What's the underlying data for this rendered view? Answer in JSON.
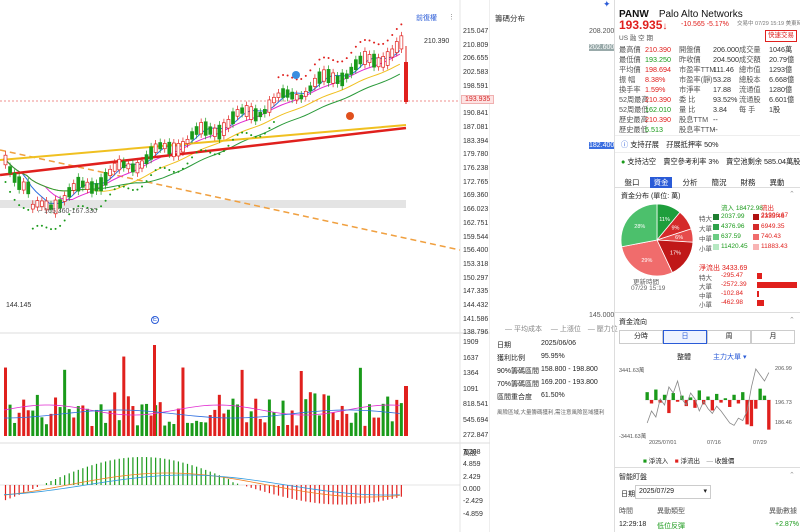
{
  "toolbar": {
    "restore_label": "前復權",
    "dist_label": "籌碼分布"
  },
  "price_axis": [
    "215.047",
    "210.809",
    "206.655",
    "202.583",
    "198.591",
    "194.677",
    "190.841",
    "187.081",
    "183.394",
    "179.780",
    "176.238",
    "172.765",
    "169.360",
    "166.023",
    "162.751",
    "159.544",
    "156.400",
    "153.318",
    "150.297",
    "147.335",
    "144.432",
    "141.586",
    "138.796"
  ],
  "current_price_tag": "193.935",
  "chart_annotations": {
    "high": "210.390",
    "low": "144.145",
    "gap": "165.360-167.330"
  },
  "dist_axis": {
    "top": "208.200",
    "p1": "202.600",
    "p2": "182.400",
    "bottom": "145.000"
  },
  "dist_legend": {
    "avg": "平均成本",
    "up": "上漲位",
    "pressure": "壓力位"
  },
  "dist_info": {
    "date_label": "日期",
    "date": "2025/06/06",
    "profit_label": "獲利比例",
    "profit": "95.95%",
    "r90_label": "90%籌碼區間",
    "r90": "158.800 - 198.800",
    "r70_label": "70%籌碼區間",
    "r70": "169.200 - 193.800",
    "conc_label": "區間重合度",
    "conc": "61.50%",
    "note": "風險區域,大量籌碼獲利,需注意風險區域獲利"
  },
  "volume_axis": [
    "1909",
    "1637",
    "1364",
    "1091",
    "818.541",
    "545.694",
    "272.847",
    "萬股"
  ],
  "macd_axis": [
    "7.288",
    "4.859",
    "2.429",
    "0.000",
    "-2.429",
    "-4.859"
  ],
  "header": {
    "symbol": "PANW",
    "name": "Palo Alto Networks",
    "price": "193.935",
    "arrow": "↓",
    "change": "-10.565",
    "pct": "-5.17%",
    "time": "交易中 07/29 15:19 美東時間",
    "trade_btn": "快速交易",
    "flags": "US 融 空 期"
  },
  "stats": [
    [
      "最高價",
      "210.390",
      "開盤價",
      "206.000",
      "成交量",
      "1046萬"
    ],
    [
      "最低價",
      "193.250",
      "昨收價",
      "204.500",
      "成交額",
      "20.79億"
    ],
    [
      "平均價",
      "198.694",
      "市盈率TTM",
      "111.46",
      "總市值",
      "1293億"
    ],
    [
      "振 幅",
      "8.38%",
      "市盈率(靜)",
      "53.28",
      "總股本",
      "6.668億"
    ],
    [
      "換手率",
      "1.59%",
      "市淨率",
      "17.88",
      "流通值",
      "1280億"
    ],
    [
      "52周最高",
      "210.390",
      "委 比",
      "93.52%",
      "流通股",
      "6.601億"
    ],
    [
      "52周最低",
      "162.010",
      "量 比",
      "3.84",
      "每 手",
      "1股"
    ],
    [
      "歷史最高",
      "210.390",
      "股息TTM",
      "--",
      "",
      ""
    ],
    [
      "歷史最低",
      "6.513",
      "股息率TTM",
      "--",
      "",
      ""
    ]
  ],
  "support": {
    "margin": "支持孖展",
    "margin_rate": "孖展抵押率 50%",
    "short": "支持沽空",
    "short_ref": "賣空參考利率 3%",
    "short_remain": "賣空池剩余 585.04萬股"
  },
  "tabs": [
    "盤口",
    "資金",
    "分析",
    "簡況",
    "財務",
    "異動"
  ],
  "funds": {
    "title": "資金分布 (單位: 萬)",
    "in_label": "流入",
    "in": "18472.98",
    "out_label": "流出",
    "out": "21906.67",
    "rows": [
      {
        "label": "特大",
        "in": "2037.99",
        "out": "2333.46"
      },
      {
        "label": "大單",
        "in": "4376.96",
        "out": "6949.35"
      },
      {
        "label": "中單",
        "in": "637.59",
        "out": "740.43"
      },
      {
        "label": "小單",
        "in": "11420.45",
        "out": "11883.43"
      }
    ],
    "net_label": "淨流出",
    "net": "3433.69",
    "net_rows": [
      {
        "label": "特大",
        "val": "-295.47"
      },
      {
        "label": "大單",
        "val": "-2572.39"
      },
      {
        "label": "中單",
        "val": "-102.84"
      },
      {
        "label": "小單",
        "val": "-462.98"
      }
    ],
    "update_label": "更新時間",
    "update": "07/29 15:19",
    "pie": [
      {
        "label": "11%",
        "value": 11,
        "color": "#1e9e3c"
      },
      {
        "label": "9%",
        "value": 9,
        "color": "#d42a2a"
      },
      {
        "label": "6%",
        "value": 6,
        "color": "#e64b4b"
      },
      {
        "label": "17%",
        "value": 17,
        "color": "#c01818"
      },
      {
        "label": "29%",
        "value": 29,
        "color": "#f06c6c"
      },
      {
        "label": "28%",
        "value": 28,
        "color": "#4cc06c"
      }
    ]
  },
  "flow": {
    "title": "資金流向",
    "periods": [
      "分時",
      "日",
      "周",
      "月"
    ],
    "sub_tabs": [
      "整體",
      "主力大單"
    ],
    "y_top": "3441.63萬",
    "y_bottom": "-3441.63萬",
    "p_top": "206.99",
    "p_mid": "196.73",
    "p_bottom": "186.46",
    "dates": [
      "2025/07/01",
      "07/16",
      "07/29"
    ],
    "legend": [
      "淨流入",
      "淨流出",
      "收盤價"
    ],
    "net_bars": [
      900,
      -400,
      1200,
      -300,
      600,
      -1500,
      800,
      -200,
      500,
      -700,
      300,
      -900,
      1100,
      -500,
      400,
      -1200,
      700,
      -300,
      200,
      -800,
      600,
      -400,
      900,
      -2800,
      -3000,
      -1000,
      1300,
      500,
      -3400
    ]
  },
  "orders": {
    "title": "智能盯盤",
    "date_label": "日期",
    "date": "2025/07/29",
    "h_time": "時間",
    "h_type": "異動類型",
    "h_data": "異動數據",
    "time": "12:29:18",
    "type": "低位反彈",
    "data": "+2.87%"
  }
}
